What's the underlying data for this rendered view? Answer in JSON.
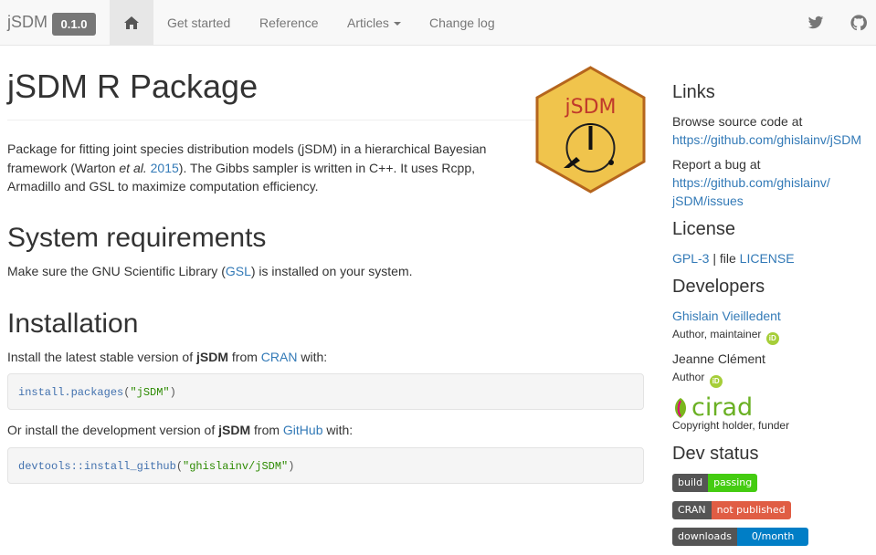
{
  "navbar": {
    "brand": "jSDM",
    "version": "0.1.0",
    "home_icon": "home-icon",
    "links": [
      "Get started",
      "Reference",
      "Articles",
      "Change log"
    ],
    "social_icons": [
      "twitter-icon",
      "github-icon"
    ]
  },
  "main": {
    "title": "jSDM R Package",
    "intro": {
      "before": "Package for fitting joint species distribution models (jSDM) in a hierarchical Bayesian framework (Warton ",
      "etal": "et al.",
      "space": " ",
      "year": "2015",
      "after": "). The Gibbs sampler is written in C++. It uses Rcpp, Armadillo and GSL to maximize computation efficiency."
    },
    "logo": {
      "text": "jSDM"
    },
    "sysreq": {
      "heading": "System requirements",
      "before": "Make sure the GNU Scientific Library (",
      "link": "GSL",
      "after": ") is installed on your system."
    },
    "install": {
      "heading": "Installation",
      "stable_before": "Install the latest stable version of ",
      "stable_bold": "jSDM",
      "stable_mid": " from ",
      "stable_link": "CRAN",
      "stable_after": " with:",
      "code1_fn": "install.packages",
      "code1_arg": "\"jSDM\"",
      "dev_before": "Or install the development version of ",
      "dev_bold": "jSDM",
      "dev_mid": " from ",
      "dev_link": "GitHub",
      "dev_after": " with:",
      "code2_fn": "devtools::install_github",
      "code2_arg": "\"ghislainv/jSDM\""
    }
  },
  "sidebar": {
    "links_heading": "Links",
    "browse_label": "Browse source code at",
    "browse_url": "https://github.com/ghislainv/jSDM",
    "bug_label": "Report a bug at",
    "bug_url_1": "https://github.com/ghislainv/",
    "bug_url_2": "jSDM/issues",
    "license_heading": "License",
    "license_link": "GPL-3",
    "license_mid": " | file ",
    "license_file": "LICENSE",
    "dev_heading": "Developers",
    "dev1_name": "Ghislain Vieilledent",
    "dev1_role": "Author, maintainer",
    "dev2_name": "Jeanne Clément",
    "dev2_role": "Author",
    "orcid_text": "iD",
    "cirad_word": "cirad",
    "cirad_role": "Copyright holder, funder",
    "status_heading": "Dev status",
    "badges": [
      {
        "key": "build",
        "value": "passing",
        "color": "#4c1"
      },
      {
        "key": "CRAN",
        "value": "not published",
        "color": "#e05d44"
      },
      {
        "key": "downloads",
        "value": "0/month",
        "color": "#007ec6"
      }
    ]
  }
}
